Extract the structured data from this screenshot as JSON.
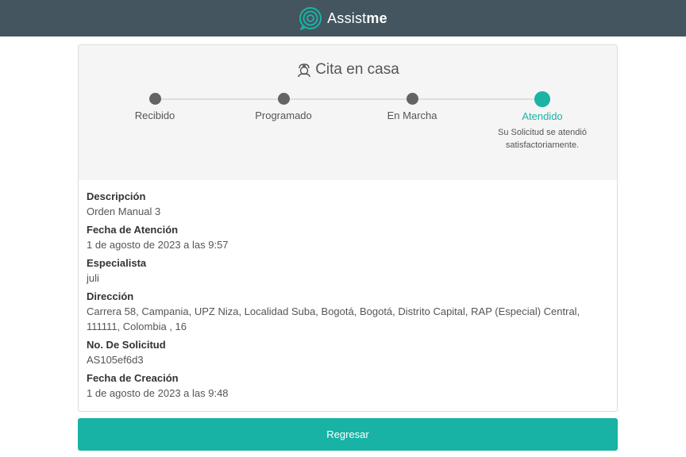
{
  "header": {
    "brand_light": "Assist",
    "brand_bold": "me",
    "bg_color": "#445560"
  },
  "card": {
    "title": "Cita en casa",
    "title_icon": "nurse-icon",
    "accent_color": "#1ab3a4"
  },
  "stepper": {
    "steps": [
      {
        "label": "Recibido",
        "state": "done"
      },
      {
        "label": "Programado",
        "state": "done"
      },
      {
        "label": "En Marcha",
        "state": "done"
      },
      {
        "label": "Atendido",
        "state": "active",
        "description": "Su Solicitud se atendió satisfactoriamente."
      }
    ]
  },
  "details": [
    {
      "label": "Descripción",
      "value": "Orden Manual 3"
    },
    {
      "label": "Fecha de Atención",
      "value": "1 de agosto de 2023 a las 9:57"
    },
    {
      "label": "Especialista",
      "value": "juli"
    },
    {
      "label": "Dirección",
      "value": "Carrera 58, Campania, UPZ Niza, Localidad Suba, Bogotá, Bogotá, Distrito Capital, RAP (Especial) Central, 111111, Colombia , 16"
    },
    {
      "label": "No. De Solicitud",
      "value": "AS105ef6d3"
    },
    {
      "label": "Fecha de Creación",
      "value": "1 de agosto de 2023 a las 9:48"
    }
  ],
  "actions": {
    "back_label": "Regresar",
    "button_color": "#18b3a4"
  }
}
